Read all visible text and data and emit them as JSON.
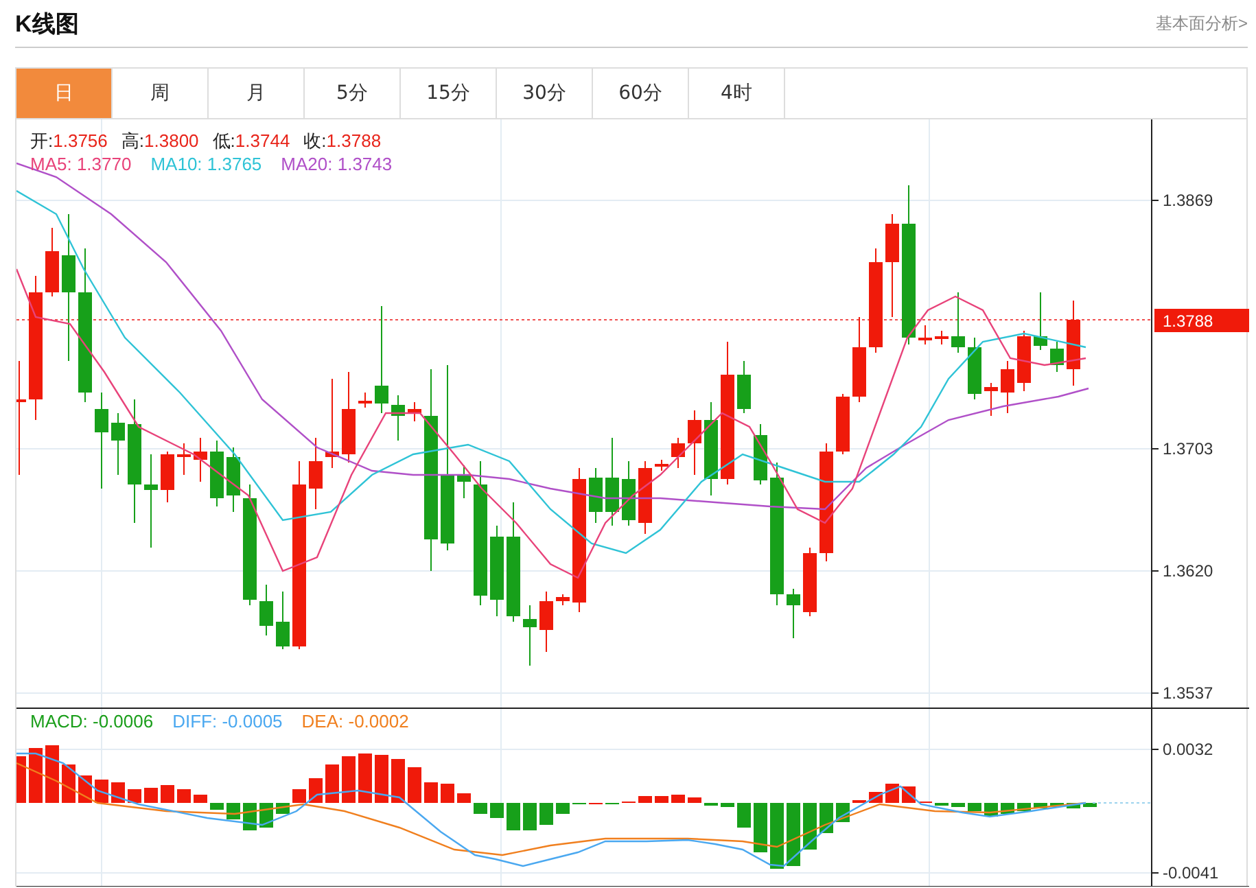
{
  "header": {
    "title": "K线图",
    "link": "基本面分析>"
  },
  "tabs": [
    {
      "label": "日",
      "selected": true
    },
    {
      "label": "周",
      "selected": false
    },
    {
      "label": "月",
      "selected": false
    },
    {
      "label": "5分",
      "selected": false
    },
    {
      "label": "15分",
      "selected": false
    },
    {
      "label": "30分",
      "selected": false
    },
    {
      "label": "60分",
      "selected": false
    },
    {
      "label": "4时",
      "selected": false
    }
  ],
  "price_chart": {
    "ohlc": [
      {
        "label": "开:",
        "value": "1.3756"
      },
      {
        "label": "高:",
        "value": "1.3800"
      },
      {
        "label": "低:",
        "value": "1.3744"
      },
      {
        "label": "收:",
        "value": "1.3788"
      }
    ],
    "moving_averages": [
      {
        "label": "MA5:",
        "value": "1.3770",
        "color": "#e8437a"
      },
      {
        "label": "MA10:",
        "value": "1.3765",
        "color": "#2fc3d6"
      },
      {
        "label": "MA20:",
        "value": "1.3743",
        "color": "#b050c8"
      }
    ],
    "y_axis": [
      "1.3869",
      "1.3703",
      "1.3620",
      "1.3537"
    ],
    "last_price": "1.3788"
  },
  "macd_chart": {
    "legend": [
      {
        "label": "MACD:",
        "value": "-0.0006",
        "color": "#1a9e1a"
      },
      {
        "label": "DIFF:",
        "value": "-0.0005",
        "color": "#4aa8f0"
      },
      {
        "label": "DEA:",
        "value": "-0.0002",
        "color": "#f07f1e"
      }
    ],
    "y_axis": [
      "0.0032",
      "-0.0041"
    ]
  }
}
